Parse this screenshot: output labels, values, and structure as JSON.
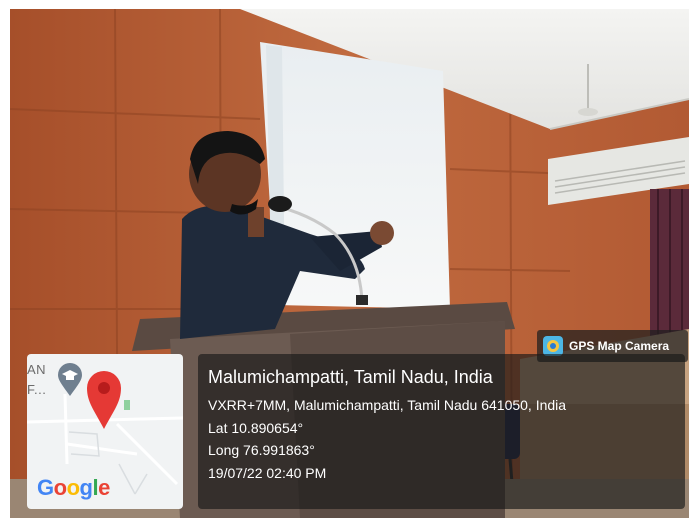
{
  "badge": {
    "label": "GPS Map Camera",
    "icon": "gps-map-camera-logo-icon"
  },
  "map": {
    "label_line1": "AN",
    "label_line2": "F...",
    "google_logo_text": [
      "G",
      "o",
      "o",
      "g",
      "l",
      "e"
    ],
    "pin_icon": "location-pin-icon",
    "poi_icon": "education-poi-icon"
  },
  "location": {
    "title": "Malumichampatti, Tamil Nadu, India",
    "address": "VXRR+7MM, Malumichampatti, Tamil Nadu 641050, India",
    "latitude": "Lat 10.890654°",
    "longitude": "Long 76.991863°",
    "datetime": "19/07/22 02:40 PM"
  },
  "colors": {
    "wall": "#b8623a",
    "pin": "#e53935",
    "overlay": "#191919"
  }
}
